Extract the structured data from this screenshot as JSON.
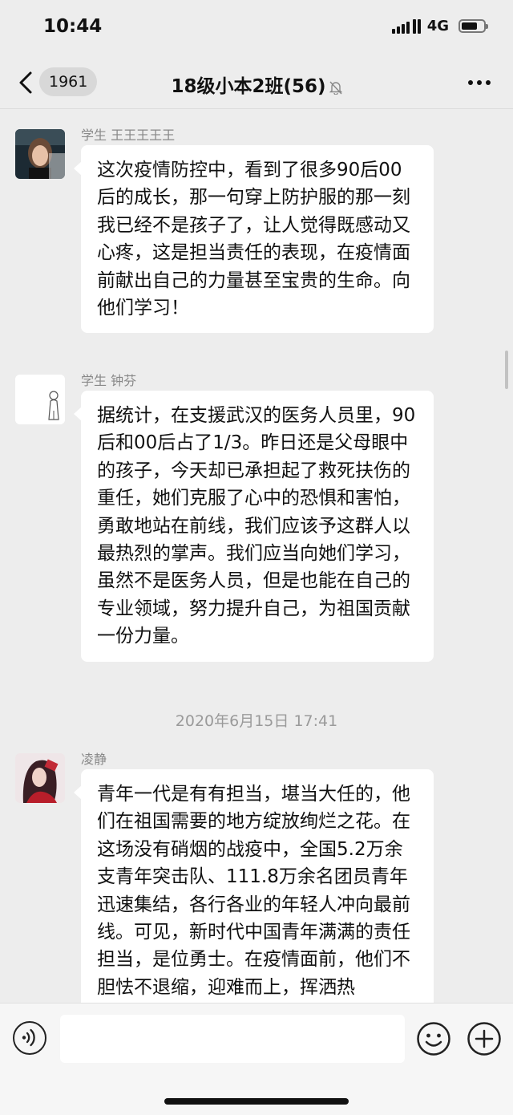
{
  "status_bar": {
    "time": "10:44",
    "network": "4G",
    "battery_level": 0.74
  },
  "nav": {
    "back_badge": "1961",
    "title": "18级小本2班(56)",
    "muted": true
  },
  "messages": [
    {
      "sender": "学生 王王王王王",
      "text": "这次疫情防控中，看到了很多90后00后的成长，那一句穿上防护服的那一刻我已经不是孩子了，让人觉得既感动又心疼，这是担当责任的表现，在疫情面前献出自己的力量甚至宝贵的生命。向他们学习！"
    },
    {
      "sender": "学生 钟芬",
      "text": "据统计，在支援武汉的医务人员里，90后和00后占了1/3。昨日还是父母眼中的孩子，今天却已承担起了救死扶伤的重任，她们克服了心中的恐惧和害怕，勇敢地站在前线，我们应该予这群人以最热烈的掌声。我们应当向她们学习，虽然不是医务人员，但是也能在自己的专业领域，努力提升自己，为祖国贡献一份力量。"
    },
    {
      "sender": "凌静",
      "text": "青年一代是有有担当，堪当大任的，他们在祖国需要的地方绽放绚烂之花。在这场没有硝烟的战疫中，全国5.2万余支青年突击队、111.8万余名团员青年迅速集结，各行各业的年轻人冲向最前线。可见，新时代中国青年满满的责任担当，是位勇士。在疫情面前，他们不胆怯不退缩，迎难而上，挥洒热"
    }
  ],
  "timestamp": "2020年6月15日 17:41",
  "icons": {
    "back": "chevron-left-icon",
    "mute": "bell-off-icon",
    "more": "more-dots-icon",
    "voice": "voice-icon",
    "emoji": "emoji-icon",
    "plus": "plus-circle-icon"
  }
}
